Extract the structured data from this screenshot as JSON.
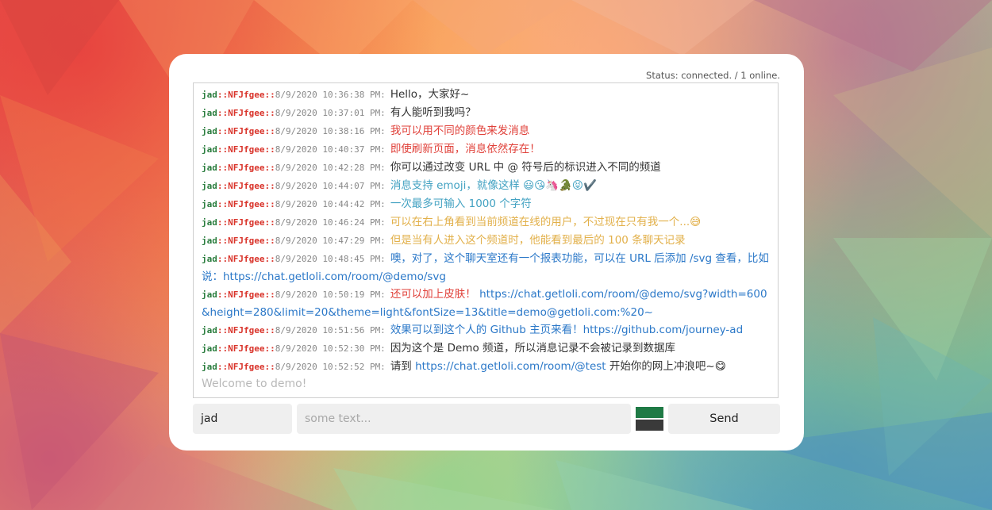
{
  "status": "Status: connected. / 1 online.",
  "theme": {
    "name_color": "#2a7d3e",
    "room_color": "#d9342b",
    "link_color": "#2b78c8"
  },
  "messages": [
    {
      "name": "jad",
      "room": "::NFJfgee::",
      "time": "8/9/2020 10:36:38 PM:",
      "text": "Hello，大家好~",
      "color": "#333333"
    },
    {
      "name": "jad",
      "room": "::NFJfgee::",
      "time": "8/9/2020 10:37:01 PM:",
      "text": "有人能听到我吗？",
      "color": "#333333"
    },
    {
      "name": "jad",
      "room": "::NFJfgee::",
      "time": "8/9/2020 10:38:16 PM:",
      "text": "我可以用不同的颜色来发消息",
      "color": "#e0413a"
    },
    {
      "name": "jad",
      "room": "::NFJfgee::",
      "time": "8/9/2020 10:40:37 PM:",
      "text": "即使刷新页面，消息依然存在！",
      "color": "#e0413a"
    },
    {
      "name": "jad",
      "room": "::NFJfgee::",
      "time": "8/9/2020 10:42:28 PM:",
      "text": "你可以通过改变 URL 中 @ 符号后的标识进入不同的频道",
      "color": "#333333"
    },
    {
      "name": "jad",
      "room": "::NFJfgee::",
      "time": "8/9/2020 10:44:07 PM:",
      "text": "消息支持 emoji，就像这样 😃😘🦄🐊😝✔️",
      "color": "#43a2c2"
    },
    {
      "name": "jad",
      "room": "::NFJfgee::",
      "time": "8/9/2020 10:44:42 PM:",
      "text": "一次最多可输入 1000 个字符",
      "color": "#43a2c2"
    },
    {
      "name": "jad",
      "room": "::NFJfgee::",
      "time": "8/9/2020 10:46:24 PM:",
      "text": "可以在右上角看到当前频道在线的用户，不过现在只有我一个...😅",
      "color": "#e2b04a"
    },
    {
      "name": "jad",
      "room": "::NFJfgee::",
      "time": "8/9/2020 10:47:29 PM:",
      "text": "但是当有人进入这个频道时，他能看到最后的 100 条聊天记录",
      "color": "#e2b04a"
    },
    {
      "name": "jad",
      "room": "::NFJfgee::",
      "time": "8/9/2020 10:48:45 PM:",
      "text": "噢，对了，这个聊天室还有一个报表功能，可以在 URL 后添加 /svg 查看，比如说：https://chat.getloli.com/room/@demo/svg",
      "color": "#2b78c8"
    },
    {
      "name": "jad",
      "room": "::NFJfgee::",
      "time": "8/9/2020 10:50:19 PM:",
      "text": "还可以加上皮肤！",
      "color": "#e0413a",
      "link": "https://chat.getloli.com/room/@demo/svg?width=600&height=280&limit=20&theme=light&fontSize=13&title=demo@getloli.com:%20~"
    },
    {
      "name": "jad",
      "room": "::NFJfgee::",
      "time": "8/9/2020 10:51:56 PM:",
      "text": "效果可以到这个人的 Github 主页来看！https://github.com/journey-ad",
      "color": "#2b78c8"
    },
    {
      "name": "jad",
      "room": "::NFJfgee::",
      "time": "8/9/2020 10:52:30 PM:",
      "text": "因为这个是 Demo 频道，所以消息记录不会被记录到数据库",
      "color": "#333333"
    },
    {
      "name": "jad",
      "room": "::NFJfgee::",
      "time": "8/9/2020 10:52:52 PM:",
      "text": "请到",
      "color": "#333333",
      "link": "https://chat.getloli.com/room/@test",
      "suffix": "开始你的网上冲浪吧~😋"
    }
  ],
  "welcome": "Welcome to demo!",
  "name_field": {
    "value": "jad"
  },
  "message_field": {
    "placeholder": "some text..."
  },
  "colors": {
    "picker_top": "#1f7a45",
    "picker_bottom": "#3a3a3a"
  },
  "send_label": "Send"
}
